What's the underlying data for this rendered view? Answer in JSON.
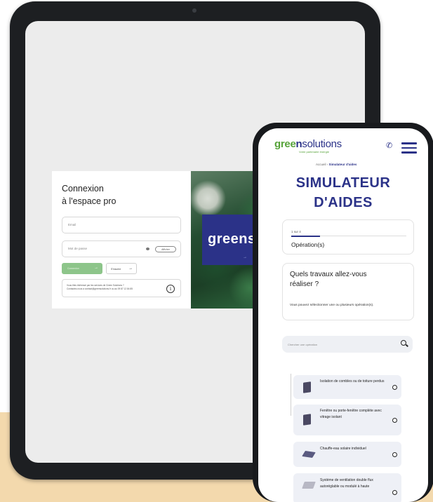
{
  "tablet": {
    "login": {
      "title_line1": "Connexion",
      "title_line2": "à l'espace pro",
      "email_placeholder": "Email",
      "password_placeholder": "Mot de passe",
      "show_label": "Afficher",
      "connect_label": "Connexion",
      "register_label": "S'inscrire",
      "info_line1": "Vous êtes intéressé par les services de Green Solutions ?",
      "info_line2": "Contactez-nous à contact@greensolutions.fr ou au 09 87 12 84 85",
      "info_icon": "i"
    },
    "brand": {
      "text": "greensolutions"
    }
  },
  "phone": {
    "logo": {
      "part1": "gree",
      "part2": "n",
      "part3": "solutions"
    },
    "tagline": "Votre partenaire énergie",
    "breadcrumb": {
      "home": "Accueil",
      "separator": " › ",
      "current": "Simulateur d'aides"
    },
    "title_line1": "SIMULATEUR",
    "title_line2": "D'AIDES",
    "step": {
      "counter": "1 sur 4",
      "progress": 0.25,
      "label": "Opération(s)"
    },
    "question": {
      "title": "Quels travaux allez-vous réaliser ?",
      "help": "Vous pouvez sélectionner une ou plusieurs opération(s)."
    },
    "search_placeholder": "Chercher une opération",
    "operations": [
      {
        "label": "Isolation de combles ou de toiture perdus",
        "icon": "insulation-panel-icon"
      },
      {
        "label": "Fenêtre ou porte-fenêtre complète avec vitrage isolant",
        "icon": "window-icon"
      },
      {
        "label": "Chauffe-eau solaire individuel",
        "icon": "solar-panel-icon"
      },
      {
        "label": "Système de ventilation double flux autoréglable ou modulé à haute",
        "icon": "ventilation-unit-icon"
      }
    ]
  },
  "colors": {
    "brand_blue": "#2b3288",
    "brand_green": "#57a33a",
    "button_green": "#8dc58a",
    "beige": "#f3d9ad"
  }
}
